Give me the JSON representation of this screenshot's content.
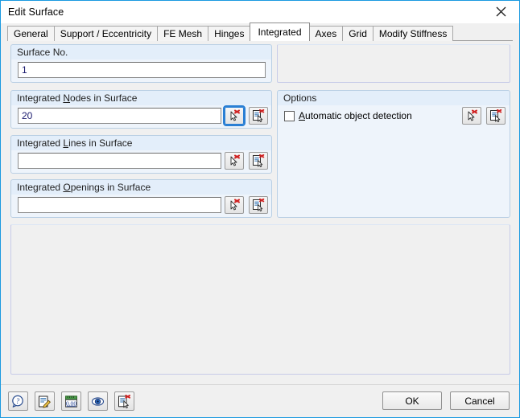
{
  "window": {
    "title": "Edit Surface",
    "close_icon": "close-icon"
  },
  "tabs": [
    {
      "label": "General",
      "active": false
    },
    {
      "label": "Support / Eccentricity",
      "active": false
    },
    {
      "label": "FE Mesh",
      "active": false
    },
    {
      "label": "Hinges",
      "active": false
    },
    {
      "label": "Integrated",
      "active": true
    },
    {
      "label": "Axes",
      "active": false
    },
    {
      "label": "Grid",
      "active": false
    },
    {
      "label": "Modify Stiffness",
      "active": false
    }
  ],
  "groups": {
    "surface_no": {
      "title_pre": "Surface No.",
      "title_mnemonic": "",
      "title_post": "",
      "value": "1"
    },
    "nodes": {
      "title_pre": "Integrated ",
      "title_mnemonic": "N",
      "title_post": "odes in Surface",
      "value": "20",
      "pick_button": "pick-objects-icon",
      "list_button": "select-from-list-icon"
    },
    "lines": {
      "title_pre": "Integrated ",
      "title_mnemonic": "L",
      "title_post": "ines in Surface",
      "value": "",
      "pick_button": "pick-objects-icon",
      "list_button": "select-from-list-icon"
    },
    "openings": {
      "title_pre": "Integrated ",
      "title_mnemonic": "O",
      "title_post": "penings in Surface",
      "value": "",
      "pick_button": "pick-objects-icon",
      "list_button": "select-from-list-icon"
    },
    "options": {
      "title_pre": "Options",
      "title_mnemonic": "",
      "title_post": "",
      "checkbox": {
        "label_pre": "",
        "label_mnemonic": "A",
        "label_post": "utomatic object detection",
        "checked": false
      },
      "pick_button": "pick-objects-icon",
      "list_button": "select-from-list-icon"
    }
  },
  "footer": {
    "tools": [
      {
        "name": "help-icon",
        "tooltip_label": "Help"
      },
      {
        "name": "edit-icon",
        "tooltip_label": "Edit"
      },
      {
        "name": "units-decimals-icon",
        "tooltip_label": "Units and Decimal Places"
      },
      {
        "name": "visibility-eye-icon",
        "tooltip_label": "Visibility"
      },
      {
        "name": "select-from-list-icon",
        "tooltip_label": "Select from List"
      }
    ],
    "ok_label": "OK",
    "cancel_label": "Cancel"
  },
  "colors": {
    "accent_border": "#1a9ae0",
    "group_caption": "#e3eefa",
    "group_bg": "#eef4fb",
    "group_border": "#b9cfe4",
    "input_text": "#1a1a6e",
    "focus_outline": "#2a7fd4",
    "dialog_bg": "#f0f0f0"
  }
}
